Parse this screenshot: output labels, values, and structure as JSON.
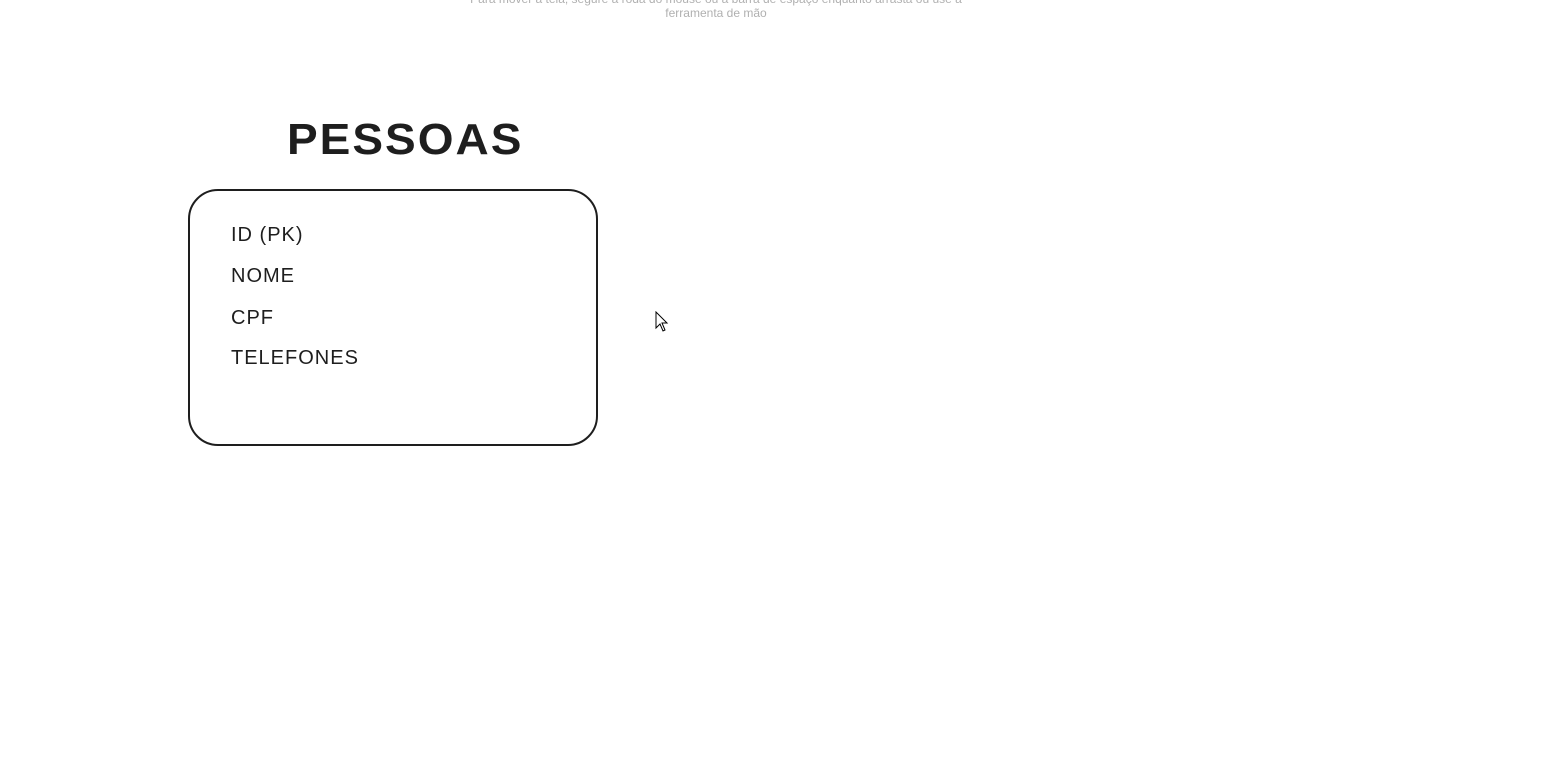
{
  "canvas_hint": "Para mover a tela, segure a roda do mouse ou a barra de espaço enquanto arrasta ou use a ferramenta de mão",
  "entity": {
    "title": "PESSOAS",
    "fields": [
      "ID (PK)",
      "NOME",
      "CPF",
      "TELEFONES"
    ]
  },
  "colors": {
    "stroke": "#1e1e1e",
    "hint": "#b0b0b0",
    "background": "#ffffff"
  }
}
